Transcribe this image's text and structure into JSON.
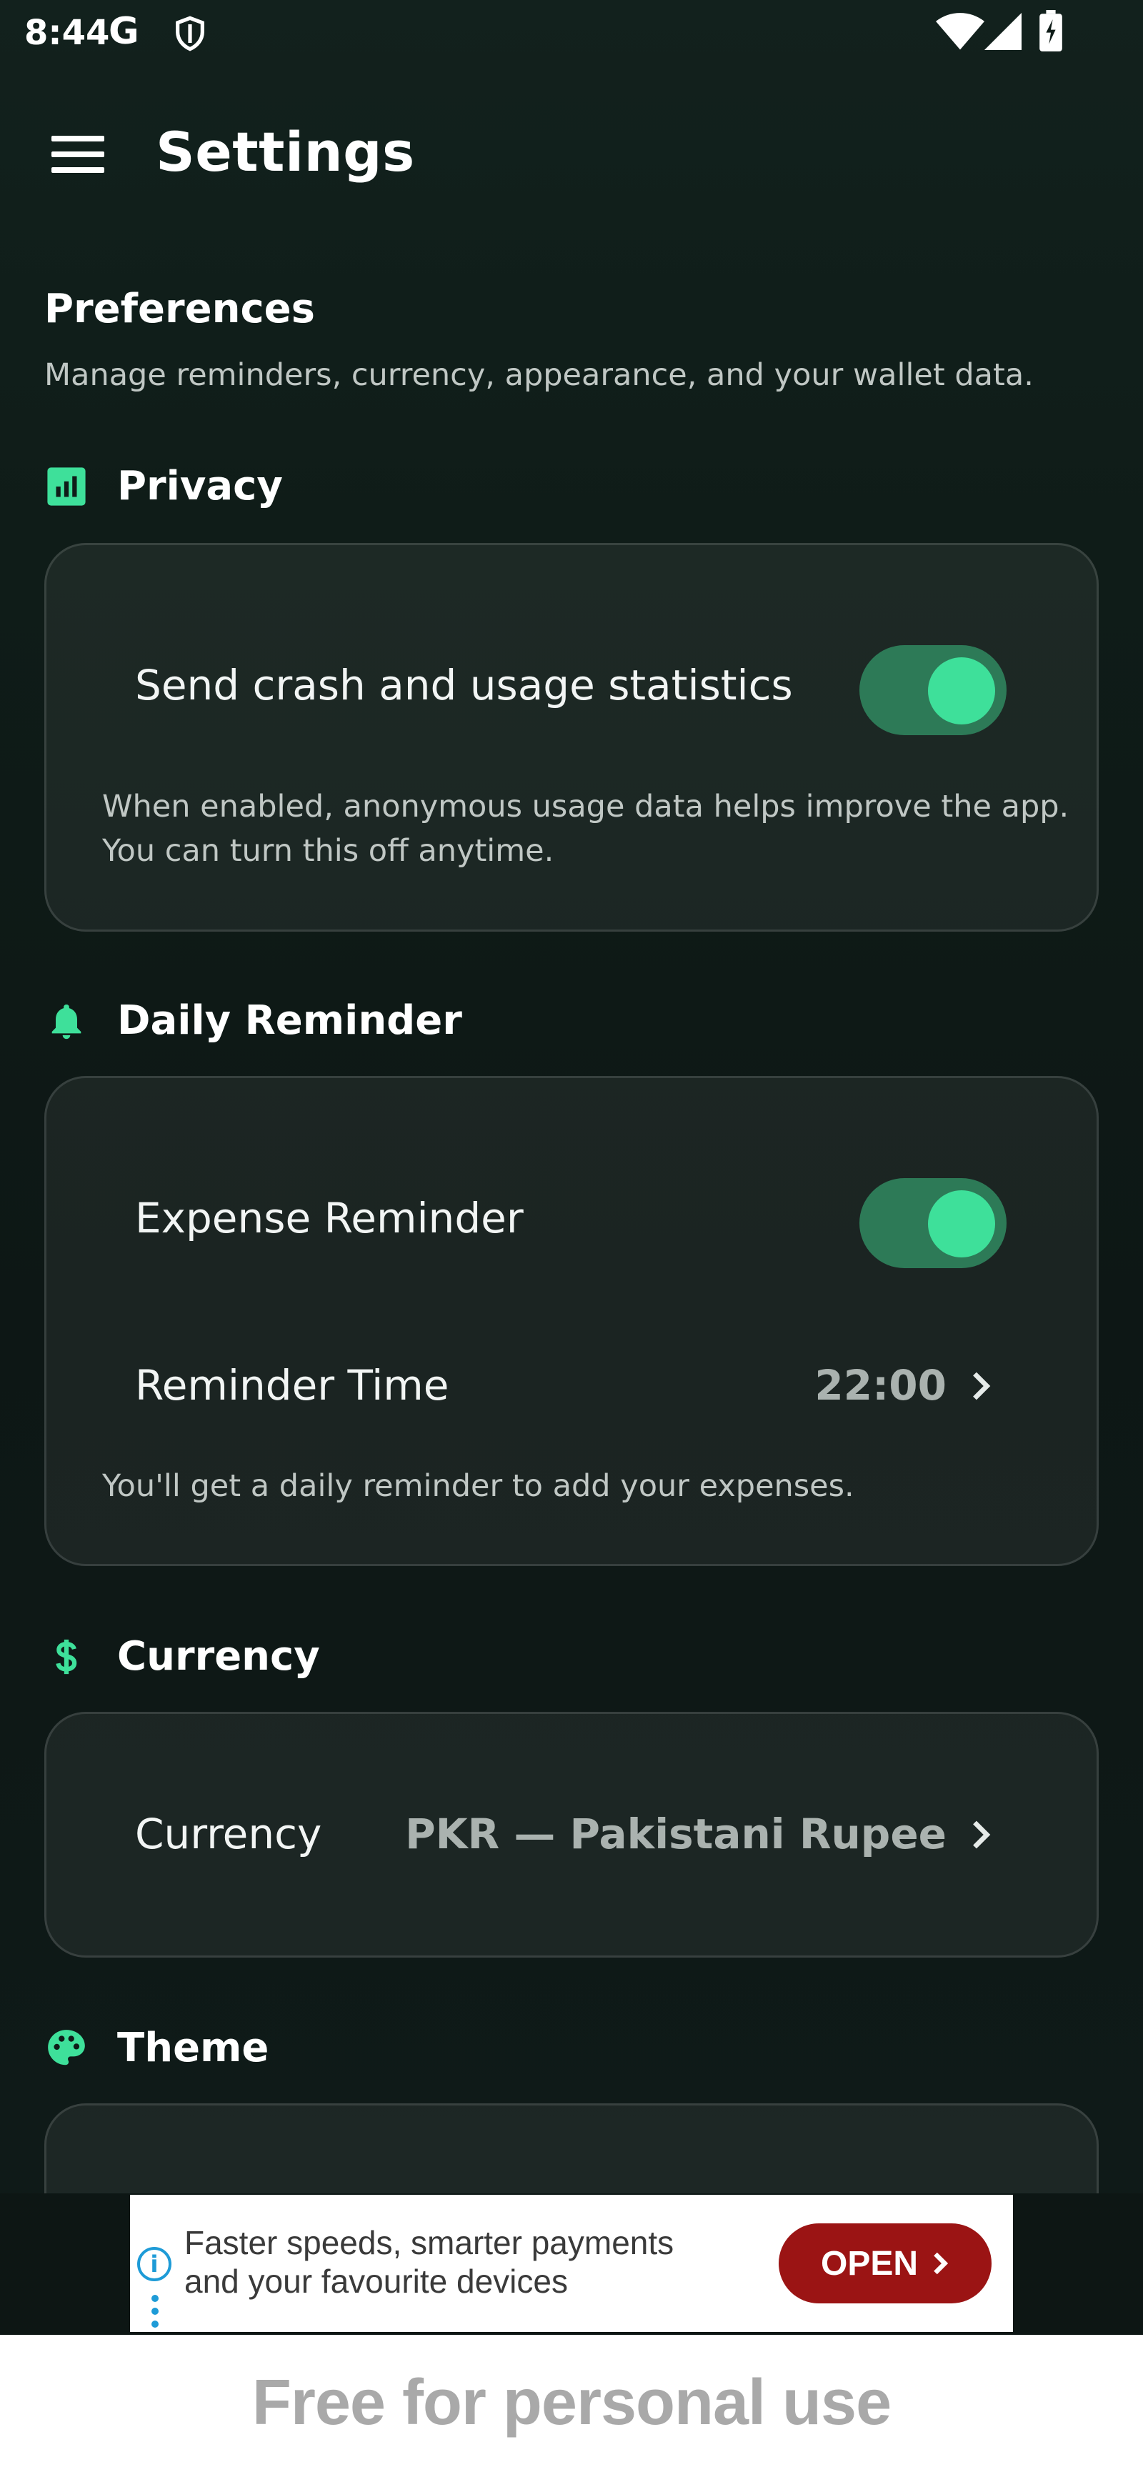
{
  "status_bar": {
    "time": "8:44",
    "carrier_glyph": "G"
  },
  "app_bar": {
    "title": "Settings"
  },
  "preferences": {
    "title": "Preferences",
    "subtitle": "Manage reminders, currency, appearance, and your wallet data."
  },
  "sections": {
    "privacy": {
      "label": "Privacy",
      "row_label": "Send crash and usage statistics",
      "toggle_on": true,
      "help_line1": "When enabled, anonymous usage data helps improve the app.",
      "help_line2": "You can turn this off anytime."
    },
    "reminder": {
      "label": "Daily Reminder",
      "expense_label": "Expense Reminder",
      "toggle_on": true,
      "time_label": "Reminder Time",
      "time_value": "22:00",
      "help": "You'll get a daily reminder to add your expenses."
    },
    "currency": {
      "label": "Currency",
      "row_label": "Currency",
      "value": "PKR — Pakistani Rupee"
    },
    "theme": {
      "label": "Theme"
    }
  },
  "ad": {
    "line1": "Faster speeds, smarter payments",
    "line2": "and your favourite devices",
    "button": "OPEN",
    "info_glyph": "i"
  },
  "watermark": "Free for personal use",
  "colors": {
    "accent": "#3ee09a",
    "toggle_track": "#2d7a57",
    "ad_button": "#9b1414"
  }
}
